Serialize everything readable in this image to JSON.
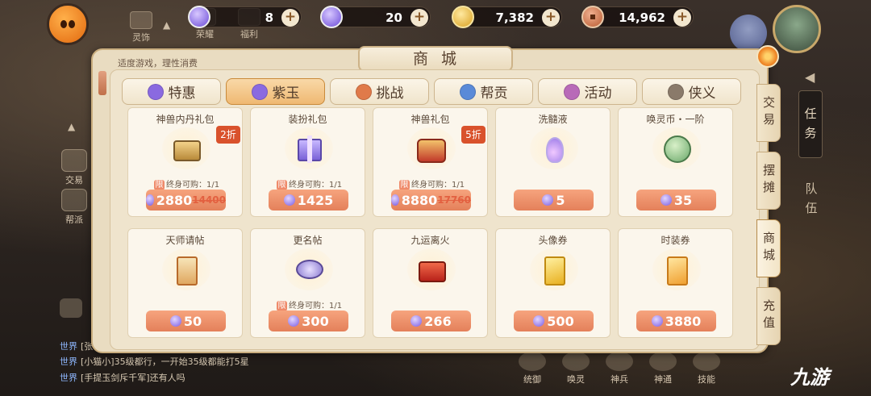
{
  "top_bar": {
    "shortcuts": [
      {
        "label": "灵饰",
        "icon": "ornament-icon"
      },
      {
        "label": "荣耀",
        "icon": "honor-icon"
      },
      {
        "label": "福利",
        "icon": "welfare-icon"
      }
    ],
    "resources": [
      {
        "name": "purple-jade",
        "value": "8",
        "icon": "purple-jade-icon"
      },
      {
        "name": "bound-jade",
        "value": "20",
        "icon": "bound-jade-icon"
      },
      {
        "name": "gold",
        "value": "7,382",
        "icon": "gold-coin-icon"
      },
      {
        "name": "copper",
        "value": "14,962",
        "icon": "copper-coin-icon"
      }
    ],
    "plus_label": "+"
  },
  "left_hud": {
    "trade_label": "交易",
    "guild_label": "帮派",
    "chat_lines": [
      {
        "channel": "世界",
        "text": "[张"
      },
      {
        "channel": "世界",
        "text": "[小猫小]35级都行，一开始35级都能打5星"
      },
      {
        "channel": "世界",
        "text": "[手提玉剑斥千军]还有人吗"
      }
    ]
  },
  "right_hud": {
    "task_label": "任务",
    "team_label": "队伍"
  },
  "bottom_skills": [
    "统御",
    "唤灵",
    "神兵",
    "神通",
    "技能"
  ],
  "brand": "九游",
  "shop": {
    "hint": "适度游戏，理性消费",
    "title": "商城",
    "tabs": [
      {
        "label": "特惠",
        "icon": "jade-icon",
        "color": "#8a6ae0",
        "active": false
      },
      {
        "label": "紫玉",
        "icon": "jade-icon",
        "color": "#8a6ae0",
        "active": true
      },
      {
        "label": "挑战",
        "icon": "challenge-token-icon",
        "color": "#e07a4a",
        "active": false
      },
      {
        "label": "帮贡",
        "icon": "guild-contribution-icon",
        "color": "#5a8ad8",
        "active": false
      },
      {
        "label": "活动",
        "icon": "event-token-icon",
        "color": "#b86ab8",
        "active": false
      },
      {
        "label": "侠义",
        "icon": "chivalry-token-icon",
        "color": "#8a7a6a",
        "active": false
      }
    ],
    "side_tabs": [
      {
        "label": "交易",
        "active": false
      },
      {
        "label": "摆摊",
        "active": false
      },
      {
        "label": "商城",
        "active": true
      },
      {
        "label": "充值",
        "active": false
      }
    ],
    "limit_tag": "限",
    "items": [
      {
        "name": "神兽内丹礼包",
        "icon": "golden-chest-icon",
        "limit": "终身可购：1/1",
        "price": "2880",
        "original_price": "14400",
        "discount": "2折"
      },
      {
        "name": "装扮礼包",
        "icon": "gift-box-icon",
        "limit": "终身可购：1/1",
        "price": "1425",
        "original_price": "",
        "discount": ""
      },
      {
        "name": "神兽礼包",
        "icon": "treasure-chest-icon",
        "limit": "终身可购：1/1",
        "price": "8880",
        "original_price": "17760",
        "discount": "5折"
      },
      {
        "name": "洗髓液",
        "icon": "potion-bottle-icon",
        "limit": "",
        "price": "5",
        "original_price": "",
        "discount": ""
      },
      {
        "name": "唤灵币・一阶",
        "icon": "jade-coin-icon",
        "limit": "",
        "price": "35",
        "original_price": "",
        "discount": ""
      },
      {
        "name": "天师请帖",
        "icon": "invitation-card-icon",
        "limit": "",
        "price": "50",
        "original_price": "",
        "discount": ""
      },
      {
        "name": "更名帖",
        "icon": "rename-tag-icon",
        "limit": "终身可购：1/1",
        "price": "300",
        "original_price": "",
        "discount": ""
      },
      {
        "name": "九运离火",
        "icon": "firecracker-icon",
        "limit": "",
        "price": "266",
        "original_price": "",
        "discount": ""
      },
      {
        "name": "头像券",
        "icon": "avatar-ticket-icon",
        "limit": "",
        "price": "500",
        "original_price": "",
        "discount": ""
      },
      {
        "name": "时装券",
        "icon": "fashion-ticket-icon",
        "limit": "",
        "price": "3880",
        "original_price": "",
        "discount": ""
      }
    ]
  }
}
